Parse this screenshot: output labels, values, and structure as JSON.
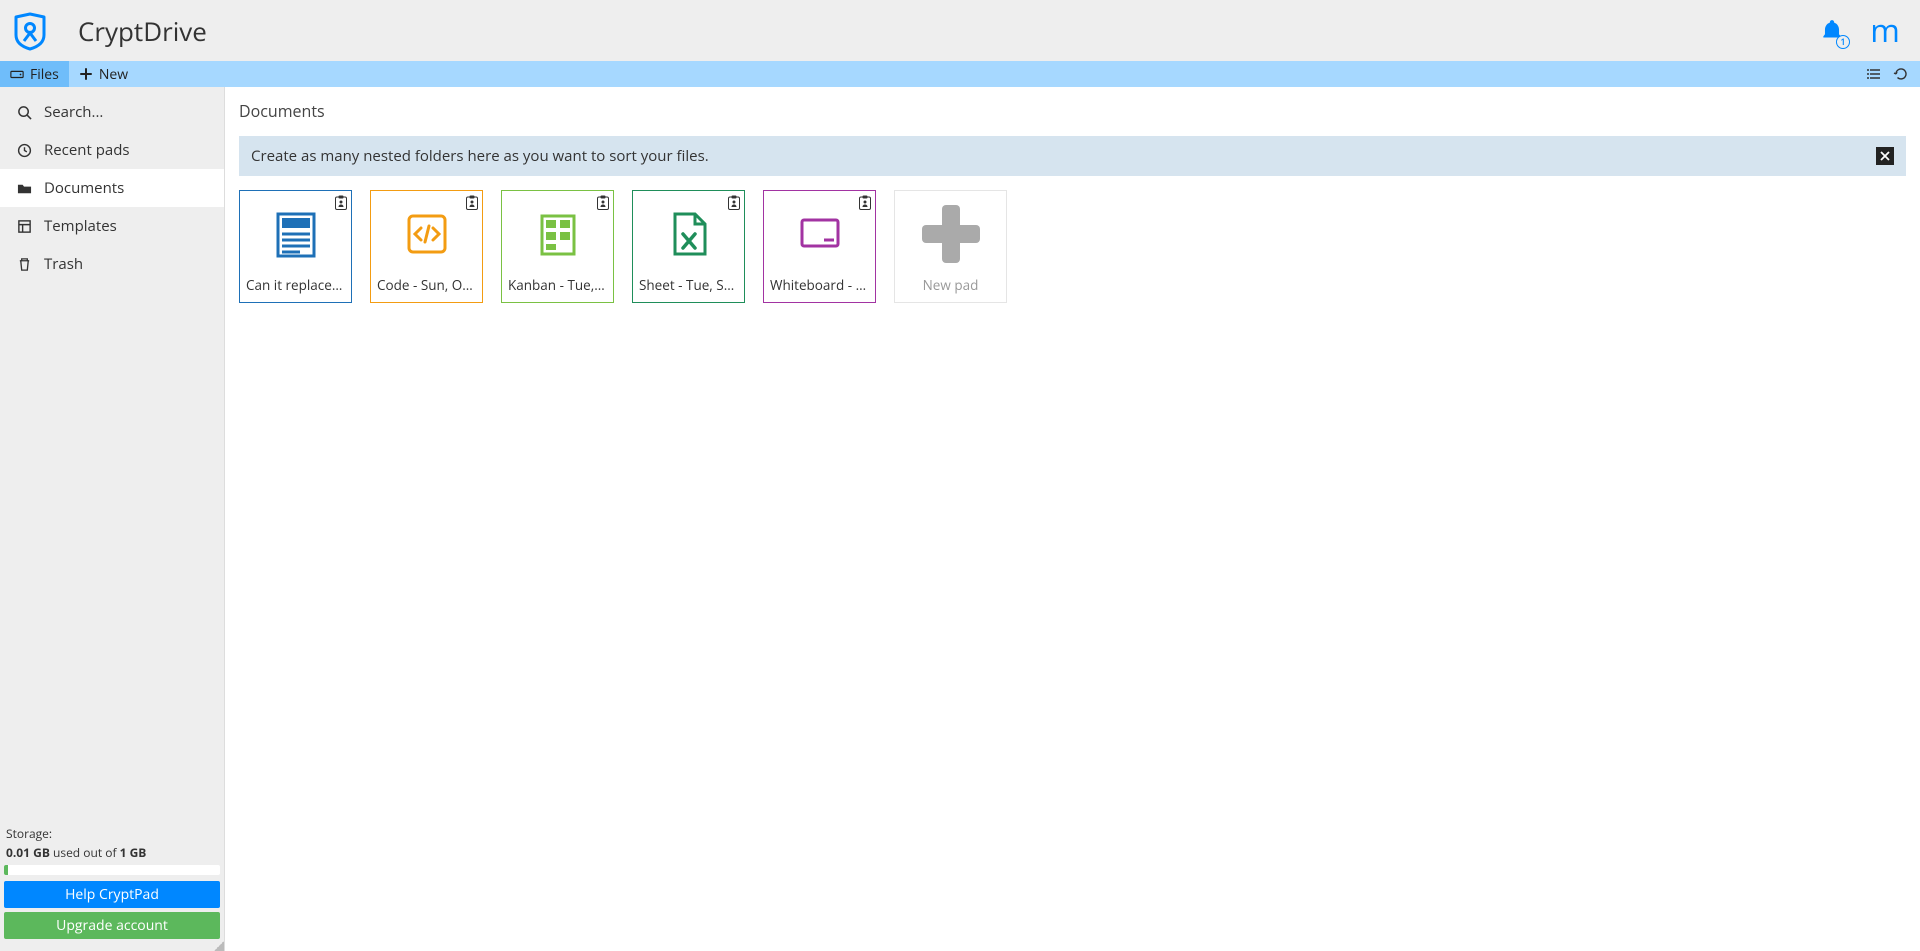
{
  "header": {
    "app_title": "CryptDrive",
    "notification_count": "1",
    "avatar_letter": "m"
  },
  "toolbar": {
    "files_label": "Files",
    "new_label": "New"
  },
  "sidebar": {
    "items": [
      {
        "id": "search",
        "label": "Search...",
        "icon": "search-icon"
      },
      {
        "id": "recent",
        "label": "Recent pads",
        "icon": "clock-icon"
      },
      {
        "id": "documents",
        "label": "Documents",
        "icon": "folder-icon",
        "active": true
      },
      {
        "id": "templates",
        "label": "Templates",
        "icon": "templates-icon"
      },
      {
        "id": "trash",
        "label": "Trash",
        "icon": "trash-icon"
      }
    ],
    "storage": {
      "label": "Storage:",
      "used_value": "0.01 GB",
      "used_text": " used out of ",
      "total_value": "1 GB",
      "percent": 1
    },
    "help_button": "Help CryptPad",
    "upgrade_button": "Upgrade account"
  },
  "main": {
    "breadcrumb": "Documents",
    "hint": "Create as many nested folders here as you want to sort your files.",
    "files": [
      {
        "name": "Can it replace Google Docs",
        "type": "pad",
        "color": "#1e70b7"
      },
      {
        "name": "Code - Sun, October…",
        "type": "code",
        "color": "#f39c12"
      },
      {
        "name": "Kanban - Tue, November…",
        "type": "kanban",
        "color": "#7ac143"
      },
      {
        "name": "Sheet - Tue, September…",
        "type": "sheet",
        "color": "#1f8e5a"
      },
      {
        "name": "Whiteboard - Tue, …",
        "type": "whiteboard",
        "color": "#a233a2"
      }
    ],
    "new_pad_label": "New pad"
  }
}
